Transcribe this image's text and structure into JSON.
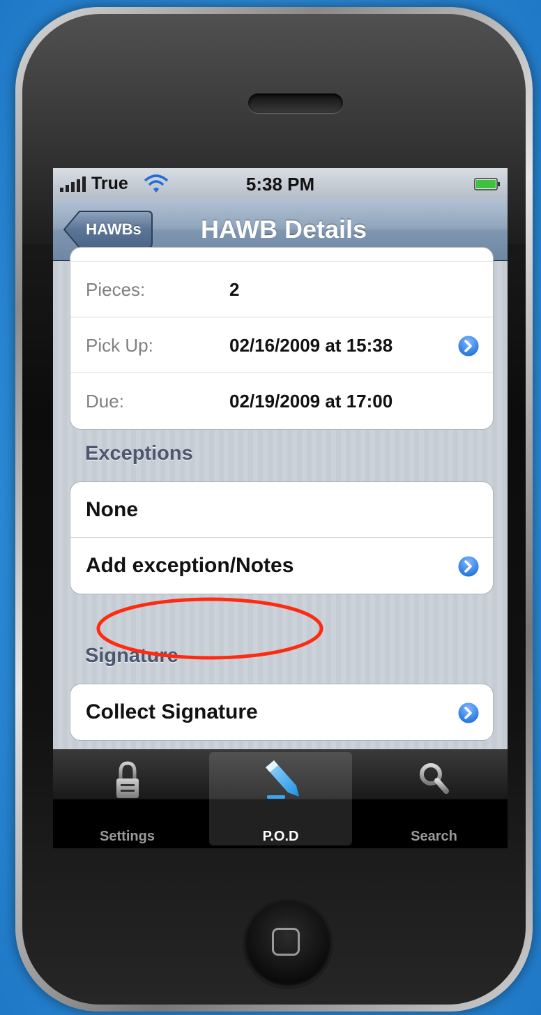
{
  "status_bar": {
    "carrier": "True",
    "time": "5:38 PM"
  },
  "nav_bar": {
    "back_label": "HAWBs",
    "title": "HAWB Details"
  },
  "details": [
    {
      "label": "Pieces:",
      "value": "2"
    },
    {
      "label": "Pick Up:",
      "value": "02/16/2009 at 15:38"
    },
    {
      "label": "Due:",
      "value": "02/19/2009 at 17:00"
    }
  ],
  "exceptions": {
    "header": "Exceptions",
    "none_label": "None",
    "add_label": "Add exception/Notes"
  },
  "signature": {
    "header": "Signature",
    "collect_label": "Collect Signature"
  },
  "tab_bar": {
    "tabs": [
      {
        "label": "Settings",
        "icon": "lock-icon"
      },
      {
        "label": "P.O.D",
        "icon": "pen-icon"
      },
      {
        "label": "Search",
        "icon": "magnifier-icon"
      }
    ],
    "selected": "P.O.D"
  },
  "colors": {
    "background": "#2f8fda",
    "nav_bar": "#7f96b0",
    "annotation": "#ff2a10",
    "disclosure": "#2a7ee0"
  }
}
